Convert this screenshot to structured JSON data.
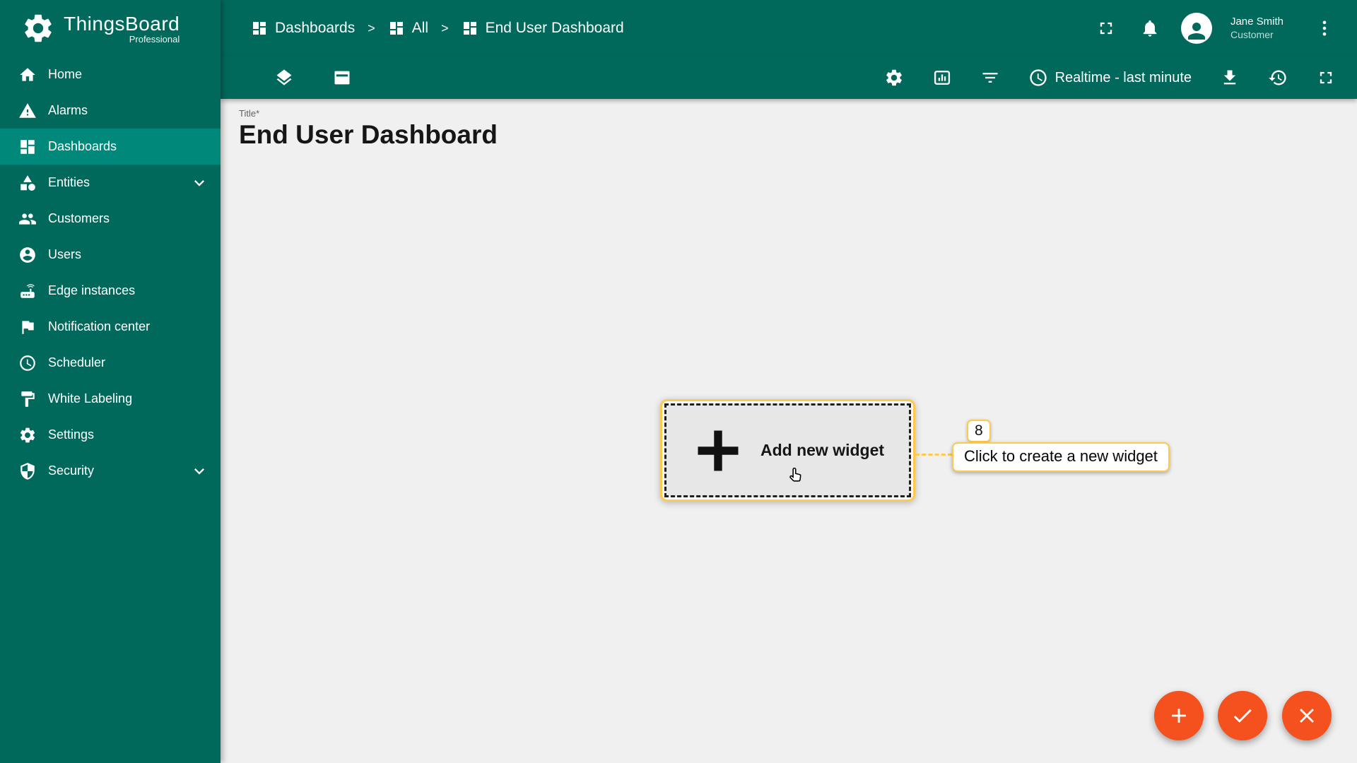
{
  "app": {
    "name": "ThingsBoard",
    "edition": "Professional"
  },
  "sidebar": {
    "items": [
      {
        "label": "Home",
        "icon": "home-icon"
      },
      {
        "label": "Alarms",
        "icon": "warning-icon"
      },
      {
        "label": "Dashboards",
        "icon": "dashboards-icon",
        "active": true
      },
      {
        "label": "Entities",
        "icon": "entities-icon",
        "expandable": true
      },
      {
        "label": "Customers",
        "icon": "customers-icon"
      },
      {
        "label": "Users",
        "icon": "users-icon"
      },
      {
        "label": "Edge instances",
        "icon": "edge-icon"
      },
      {
        "label": "Notification center",
        "icon": "flag-icon"
      },
      {
        "label": "Scheduler",
        "icon": "clock-icon"
      },
      {
        "label": "White Labeling",
        "icon": "paint-icon"
      },
      {
        "label": "Settings",
        "icon": "gear-icon"
      },
      {
        "label": "Security",
        "icon": "shield-icon",
        "expandable": true
      }
    ]
  },
  "header": {
    "breadcrumb": [
      {
        "label": "Dashboards"
      },
      {
        "label": "All"
      },
      {
        "label": "End User Dashboard"
      }
    ],
    "separator": ">",
    "user": {
      "name": "Jane Smith",
      "role": "Customer"
    }
  },
  "toolbar": {
    "time_window": "Realtime - last minute"
  },
  "main": {
    "title_label": "Title*",
    "title_value": "End User Dashboard",
    "add_widget_label": "Add new widget"
  },
  "tour": {
    "step": "8",
    "text": "Click to create a new widget"
  },
  "fabs": [
    {
      "name": "add"
    },
    {
      "name": "apply"
    },
    {
      "name": "close"
    }
  ],
  "colors": {
    "primary": "#00695c",
    "primary_active": "#00897b",
    "accent_orange": "#f4511e",
    "tour_yellow": "#ffc94d",
    "content_bg": "#f0f0f0"
  }
}
